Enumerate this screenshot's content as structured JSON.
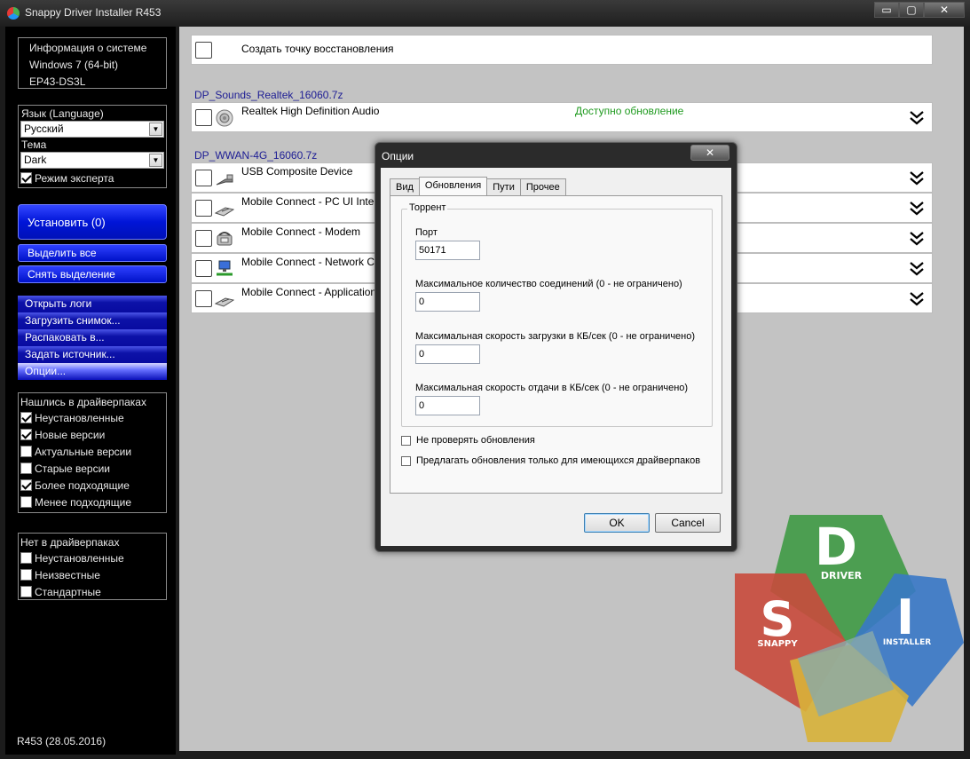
{
  "window": {
    "title": "Snappy Driver Installer R453",
    "min": "▭",
    "max": "▢",
    "close": "✕"
  },
  "sysinfo": {
    "line1": "Информация о системе",
    "line2": "Windows 7 (64-bit)",
    "line3": "EP43-DS3L"
  },
  "language": {
    "label": "Язык (Language)",
    "value": "Русский"
  },
  "theme": {
    "label": "Тема",
    "value": "Dark"
  },
  "expert_mode": {
    "label": "Режим эксперта",
    "checked": true
  },
  "actions": {
    "install": "Установить (0)",
    "select_all": "Выделить все",
    "deselect": "Снять выделение"
  },
  "menu": [
    "Открыть логи",
    "Загрузить снимок...",
    "Распаковать в...",
    "Задать источник...",
    "Опции..."
  ],
  "found_filters": {
    "title": "Нашлись в драйверпаках",
    "items": [
      {
        "label": "Неустановленные",
        "checked": true
      },
      {
        "label": "Новые версии",
        "checked": true
      },
      {
        "label": "Актуальные версии",
        "checked": false
      },
      {
        "label": "Старые версии",
        "checked": false
      },
      {
        "label": "Более подходящие",
        "checked": true
      },
      {
        "label": "Менее подходящие",
        "checked": false
      }
    ]
  },
  "missing_filters": {
    "title": "Нет в драйверпаках",
    "items": [
      {
        "label": "Неустановленные",
        "checked": false
      },
      {
        "label": "Неизвестные",
        "checked": false
      },
      {
        "label": "Стандартные",
        "checked": false
      }
    ]
  },
  "version": "R453 (28.05.2016)",
  "restore_point": "Создать точку восстановления",
  "packs": [
    {
      "title": "DP_Sounds_Realtek_16060.7z",
      "devices": [
        {
          "name": "Realtek High Definition Audio",
          "status": "Доступно обновление",
          "icon": "speaker-icon"
        }
      ]
    },
    {
      "title": "DP_WWAN-4G_16060.7z",
      "devices": [
        {
          "name": "USB Composite Device",
          "status": "",
          "icon": "usb-icon"
        },
        {
          "name": "Mobile Connect - PC UI Inte",
          "status": "",
          "icon": "modem-icon"
        },
        {
          "name": "Mobile Connect - Modem",
          "status": "",
          "icon": "phone-modem-icon"
        },
        {
          "name": "Mobile Connect - Network C",
          "status": "",
          "icon": "network-icon"
        },
        {
          "name": "Mobile Connect - Application",
          "status": "",
          "icon": "modem-icon"
        }
      ]
    }
  ],
  "dialog": {
    "title": "Опции",
    "close": "✕",
    "tabs": [
      "Вид",
      "Обновления",
      "Пути",
      "Прочее"
    ],
    "active_tab": 1,
    "group_title": "Торрент",
    "port_label": "Порт",
    "port_value": "50171",
    "max_conn_label": "Максимальное количество соединений (0 - не ограничено)",
    "max_conn_value": "0",
    "max_down_label": "Максимальная скорость загрузки в КБ/сек (0 - не ограничено)",
    "max_down_value": "0",
    "max_up_label": "Максимальная скорость отдачи в КБ/сек (0 - не ограничено)",
    "max_up_value": "0",
    "no_check_updates": "Не проверять обновления",
    "offer_only_existing": "Предлагать обновления только для имеющихся драйверпаков",
    "ok": "OK",
    "cancel": "Cancel"
  },
  "logo": {
    "d": "D",
    "s": "S",
    "i": "I",
    "driver": "DRIVER",
    "snappy": "SNAPPY",
    "installer": "INSTALLER"
  },
  "colors": {
    "accent_blue": "#0015d8",
    "status_green": "#1f9a1f",
    "pack_title": "#1c1c94"
  }
}
